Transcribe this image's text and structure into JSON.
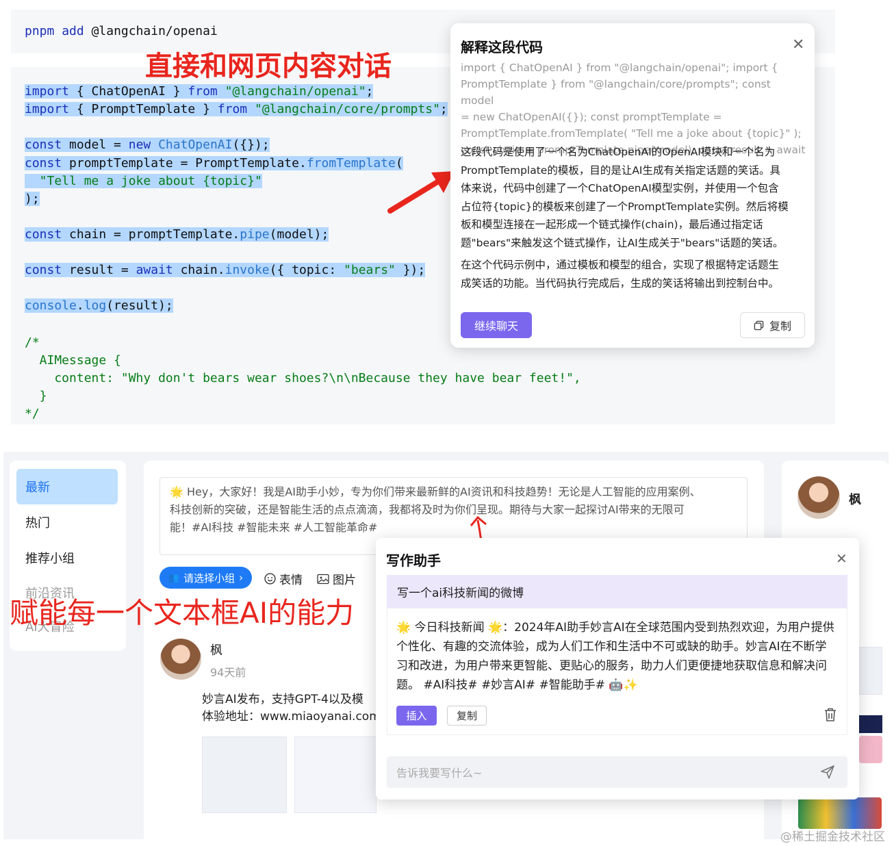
{
  "install": {
    "cmd": "pnpm",
    "sub": "add",
    "pkg": "@langchain/openai"
  },
  "annotations": {
    "top": "直接和网页内容对话",
    "bottom": "赋能每一个文本框AI的能力"
  },
  "code": {
    "import1": [
      "import",
      " { ChatOpenAI } ",
      "from",
      " ",
      "\"@langchain/openai\"",
      ";"
    ],
    "import2": [
      "import",
      " { PromptTemplate } ",
      "from",
      " ",
      "\"@langchain/core/prompts\"",
      ";"
    ],
    "model": [
      "const",
      " model = ",
      "new",
      " ",
      "ChatOpenAI",
      "({});"
    ],
    "pt1": [
      "const",
      " promptTemplate = PromptTemplate.",
      "fromTemplate",
      "("
    ],
    "pt2": "  \"Tell me a joke about {topic}\"",
    "pt3": ");",
    "chain": [
      "const",
      " chain = promptTemplate.",
      "pipe",
      "(model);"
    ],
    "result": [
      "const",
      " result = ",
      "await",
      " chain.",
      "invoke",
      "({ topic: ",
      "\"bears\"",
      " });"
    ],
    "log": [
      "console",
      ".",
      "log",
      "(result);"
    ],
    "comment": [
      "/*",
      "  AIMessage {",
      "    content: \"Why don't bears wear shoes?\\n\\nBecause they have bear feet!\",",
      "  }",
      "*/"
    ]
  },
  "explain_popup": {
    "title": "解释这段代码",
    "quote_lines": [
      "import { ChatOpenAI } from \"@langchain/openai\"; import {",
      "PromptTemplate } from \"@langchain/core/prompts\"; const model",
      "= new ChatOpenAI({}); const promptTemplate =",
      "PromptTemplate.fromTemplate( \"Tell me a joke about {topic}\" );",
      "const chain = promptTemplate.pipe(model); const result = await"
    ],
    "para1_lines": [
      "这段代码是使用了一个名为ChatOpenAI的OpenAI模块和一个名为",
      "PromptTemplate的模板，目的是让AI生成有关指定话题的笑话。具",
      "体来说，代码中创建了一个ChatOpenAI模型实例，并使用一个包含",
      "占位符{topic}的模板来创建了一个PromptTemplate实例。然后将模",
      "板和模型连接在一起形成一个链式操作(chain)，最后通过指定话",
      "题\"bears\"来触发这个链式操作，让AI生成关于\"bears\"话题的笑话。"
    ],
    "para2_lines": [
      "在这个代码示例中，通过模板和模型的组合，实现了根据特定话题生",
      "成笑话的功能。当代码执行完成后，生成的笑话将输出到控制台中。"
    ],
    "continue_label": "继续聊天",
    "copy_label": "复制"
  },
  "sidebar": {
    "items": [
      {
        "label": "最新"
      },
      {
        "label": "热门"
      },
      {
        "label": "推荐小组"
      },
      {
        "label": "前沿资讯"
      },
      {
        "label": "AI大冒险"
      }
    ]
  },
  "composer": {
    "lines": [
      "🌟 Hey，大家好！我是AI助手小妙，专为你们带来最新鲜的AI资讯和科技趋势！无论是人工智能的应用案例、",
      "科技创新的突破，还是智能生活的点点滴滴，我都将及时为你们呈现。期待与大家一起探讨AI带来的无限可",
      "能！#AI科技 #智能未来 #人工智能革命#"
    ],
    "group_label": "请选择小组",
    "emoji_label": "表情",
    "image_label": "图片"
  },
  "post": {
    "author": "枫",
    "time": "94天前",
    "line1": "妙言AI发布，支持GPT-4以及模",
    "line2": "体验地址：www.miaoyanai.com"
  },
  "profile": {
    "name": "枫"
  },
  "writing_assistant": {
    "title": "写作助手",
    "prompt": "写一个ai科技新闻的微博",
    "result_lines": [
      "🌟 今日科技新闻 🌟：2024年AI助手妙言AI在全球范围内受到热烈欢迎，为用户提供",
      "个性化、有趣的交流体验，成为人们工作和生活中不可或缺的助手。妙言AI在不断学",
      "习和改进，为用户带来更智能、更贴心的服务，助力人们更便捷地获取信息和解决问",
      "题。 #AI科技# #妙言AI# #智能助手# 🤖✨"
    ],
    "insert_label": "插入",
    "copy_label": "复制",
    "input_placeholder": "告诉我要写什么~"
  },
  "watermark": "@稀土掘金技术社区",
  "colors": {
    "accent": "#7b67ee",
    "blue": "#1e7bf5",
    "annotation": "#e8261e"
  }
}
